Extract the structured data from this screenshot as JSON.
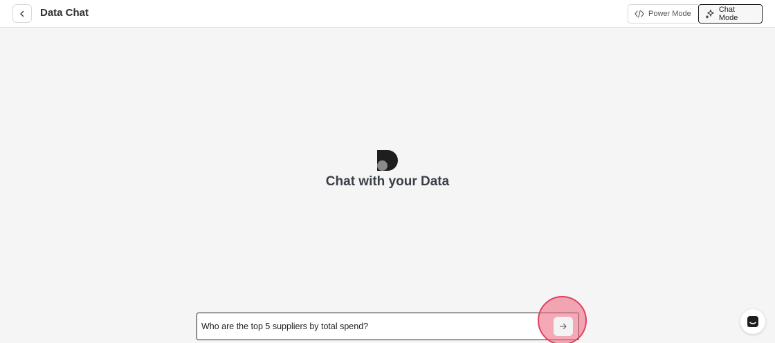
{
  "header": {
    "back_icon": "chevron-left-icon",
    "title": "Data Chat"
  },
  "mode_switch": {
    "power": {
      "label": "Power Mode",
      "icon": "code-icon",
      "active": false
    },
    "chat": {
      "label": "Chat Mode",
      "icon": "sparkle-icon",
      "active": true
    }
  },
  "hero": {
    "logo_icon": "data-logo-icon",
    "title": "Chat with your Data"
  },
  "chat_input": {
    "value": "Who are the top 5 suppliers by total spend?",
    "send_icon": "arrow-right-icon"
  },
  "help": {
    "icon": "chat-support-icon"
  },
  "colors": {
    "background": "#f5f5f5",
    "click_marker": "#e0405e",
    "border_active": "#1f1f1f"
  }
}
